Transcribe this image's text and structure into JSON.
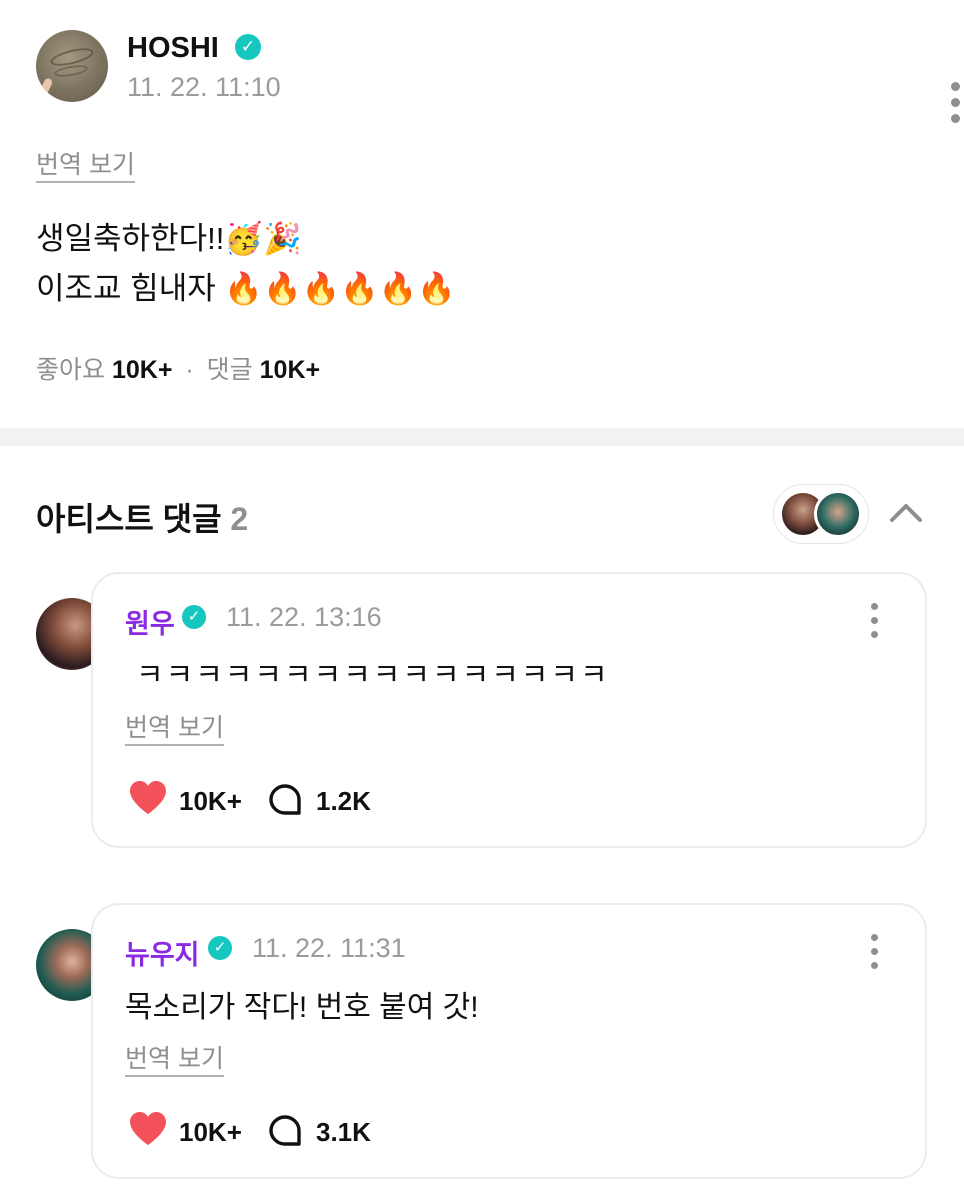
{
  "post": {
    "author": "HOSHI",
    "verified_icon": "verified-check-icon",
    "timestamp": "11. 22. 11:10",
    "translate_label": "번역 보기",
    "body_line1": "생일축하한다!!",
    "body_line1_emojis": "🥳🎉",
    "body_line2": "이조교 힘내자",
    "body_line2_emojis": "🔥🔥🔥🔥🔥🔥",
    "stats": {
      "likes_label": "좋아요",
      "likes_value": "10K+",
      "separator": "·",
      "comments_label": "댓글",
      "comments_value": "10K+"
    }
  },
  "artist_comments": {
    "title": "아티스트 댓글",
    "count": "2",
    "collapse_icon": "chevron-up-icon",
    "items": [
      {
        "name": "원우",
        "timestamp": "11. 22. 13:16",
        "text": "ㅋㅋㅋㅋㅋㅋㅋㅋㅋㅋㅋㅋㅋㅋㅋㅋ",
        "translate_label": "번역 보기",
        "likes": "10K+",
        "replies": "1.2K"
      },
      {
        "name": "뉴우지",
        "timestamp": "11. 22. 11:31",
        "text": "목소리가 작다! 번호 붙여 갓!",
        "translate_label": "번역 보기",
        "likes": "10K+",
        "replies": "3.1K"
      }
    ]
  },
  "colors": {
    "verified": "#16c7c0",
    "artist_name": "#8a2be2",
    "heart": "#f4525a",
    "muted_text": "#8e8e93"
  }
}
